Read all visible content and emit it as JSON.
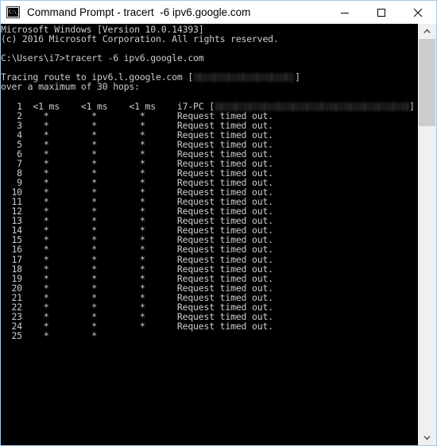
{
  "window": {
    "title": "Command Prompt - tracert  -6 ipv6.google.com",
    "icon_name": "command-prompt-icon",
    "icon_glyph": "C:\\_",
    "controls": {
      "minimize_label": "Minimize",
      "maximize_label": "Maximize",
      "close_label": "Close"
    },
    "colors": {
      "border": "#9fc7ea",
      "titlebar_bg": "#ffffff",
      "console_bg": "#000000",
      "console_fg": "#cccccc",
      "scrollbar_track": "#f0f0f0",
      "scrollbar_thumb": "#cdcdcd"
    }
  },
  "console": {
    "header_lines": [
      "Microsoft Windows [Version 10.0.14393]",
      "(c) 2016 Microsoft Corporation. All rights reserved.",
      "",
      "C:\\Users\\i7>tracert -6 ipv6.google.com",
      ""
    ],
    "trace_intro_prefix": "Tracing route to ipv6.l.google.com [",
    "trace_intro_suffix": "]",
    "trace_intro_redacted": "ipv6-address-redacted",
    "max_hops_line": "over a maximum of 30 hops:",
    "blank_line": "",
    "columns": {
      "hop": "hop",
      "rtt1": "rtt1",
      "rtt2": "rtt2",
      "rtt3": "rtt3",
      "host": "host"
    },
    "hops": [
      {
        "hop": "1",
        "rtt1": "<1 ms",
        "rtt2": "<1 ms",
        "rtt3": "<1 ms",
        "host": "i7-PC",
        "host_redacted": true,
        "redacted_width": 245,
        "result": ""
      },
      {
        "hop": "2",
        "rtt1": "*",
        "rtt2": "*",
        "rtt3": "*",
        "host": "",
        "host_redacted": false,
        "result": "Request timed out."
      },
      {
        "hop": "3",
        "rtt1": "*",
        "rtt2": "*",
        "rtt3": "*",
        "host": "",
        "host_redacted": false,
        "result": "Request timed out."
      },
      {
        "hop": "4",
        "rtt1": "*",
        "rtt2": "*",
        "rtt3": "*",
        "host": "",
        "host_redacted": false,
        "result": "Request timed out."
      },
      {
        "hop": "5",
        "rtt1": "*",
        "rtt2": "*",
        "rtt3": "*",
        "host": "",
        "host_redacted": false,
        "result": "Request timed out."
      },
      {
        "hop": "6",
        "rtt1": "*",
        "rtt2": "*",
        "rtt3": "*",
        "host": "",
        "host_redacted": false,
        "result": "Request timed out."
      },
      {
        "hop": "7",
        "rtt1": "*",
        "rtt2": "*",
        "rtt3": "*",
        "host": "",
        "host_redacted": false,
        "result": "Request timed out."
      },
      {
        "hop": "8",
        "rtt1": "*",
        "rtt2": "*",
        "rtt3": "*",
        "host": "",
        "host_redacted": false,
        "result": "Request timed out."
      },
      {
        "hop": "9",
        "rtt1": "*",
        "rtt2": "*",
        "rtt3": "*",
        "host": "",
        "host_redacted": false,
        "result": "Request timed out."
      },
      {
        "hop": "10",
        "rtt1": "*",
        "rtt2": "*",
        "rtt3": "*",
        "host": "",
        "host_redacted": false,
        "result": "Request timed out."
      },
      {
        "hop": "11",
        "rtt1": "*",
        "rtt2": "*",
        "rtt3": "*",
        "host": "",
        "host_redacted": false,
        "result": "Request timed out."
      },
      {
        "hop": "12",
        "rtt1": "*",
        "rtt2": "*",
        "rtt3": "*",
        "host": "",
        "host_redacted": false,
        "result": "Request timed out."
      },
      {
        "hop": "13",
        "rtt1": "*",
        "rtt2": "*",
        "rtt3": "*",
        "host": "",
        "host_redacted": false,
        "result": "Request timed out."
      },
      {
        "hop": "14",
        "rtt1": "*",
        "rtt2": "*",
        "rtt3": "*",
        "host": "",
        "host_redacted": false,
        "result": "Request timed out."
      },
      {
        "hop": "15",
        "rtt1": "*",
        "rtt2": "*",
        "rtt3": "*",
        "host": "",
        "host_redacted": false,
        "result": "Request timed out."
      },
      {
        "hop": "16",
        "rtt1": "*",
        "rtt2": "*",
        "rtt3": "*",
        "host": "",
        "host_redacted": false,
        "result": "Request timed out."
      },
      {
        "hop": "17",
        "rtt1": "*",
        "rtt2": "*",
        "rtt3": "*",
        "host": "",
        "host_redacted": false,
        "result": "Request timed out."
      },
      {
        "hop": "18",
        "rtt1": "*",
        "rtt2": "*",
        "rtt3": "*",
        "host": "",
        "host_redacted": false,
        "result": "Request timed out."
      },
      {
        "hop": "19",
        "rtt1": "*",
        "rtt2": "*",
        "rtt3": "*",
        "host": "",
        "host_redacted": false,
        "result": "Request timed out."
      },
      {
        "hop": "20",
        "rtt1": "*",
        "rtt2": "*",
        "rtt3": "*",
        "host": "",
        "host_redacted": false,
        "result": "Request timed out."
      },
      {
        "hop": "21",
        "rtt1": "*",
        "rtt2": "*",
        "rtt3": "*",
        "host": "",
        "host_redacted": false,
        "result": "Request timed out."
      },
      {
        "hop": "22",
        "rtt1": "*",
        "rtt2": "*",
        "rtt3": "*",
        "host": "",
        "host_redacted": false,
        "result": "Request timed out."
      },
      {
        "hop": "23",
        "rtt1": "*",
        "rtt2": "*",
        "rtt3": "*",
        "host": "",
        "host_redacted": false,
        "result": "Request timed out."
      },
      {
        "hop": "24",
        "rtt1": "*",
        "rtt2": "*",
        "rtt3": "*",
        "host": "",
        "host_redacted": false,
        "result": "Request timed out."
      },
      {
        "hop": "25",
        "rtt1": "*",
        "rtt2": "*",
        "rtt3": "",
        "host": "",
        "host_redacted": false,
        "result": ""
      }
    ]
  },
  "scrollbar": {
    "up_arrow": "scroll-up-arrow-icon",
    "down_arrow": "scroll-down-arrow-icon",
    "thumb_name": "scrollbar-thumb"
  }
}
